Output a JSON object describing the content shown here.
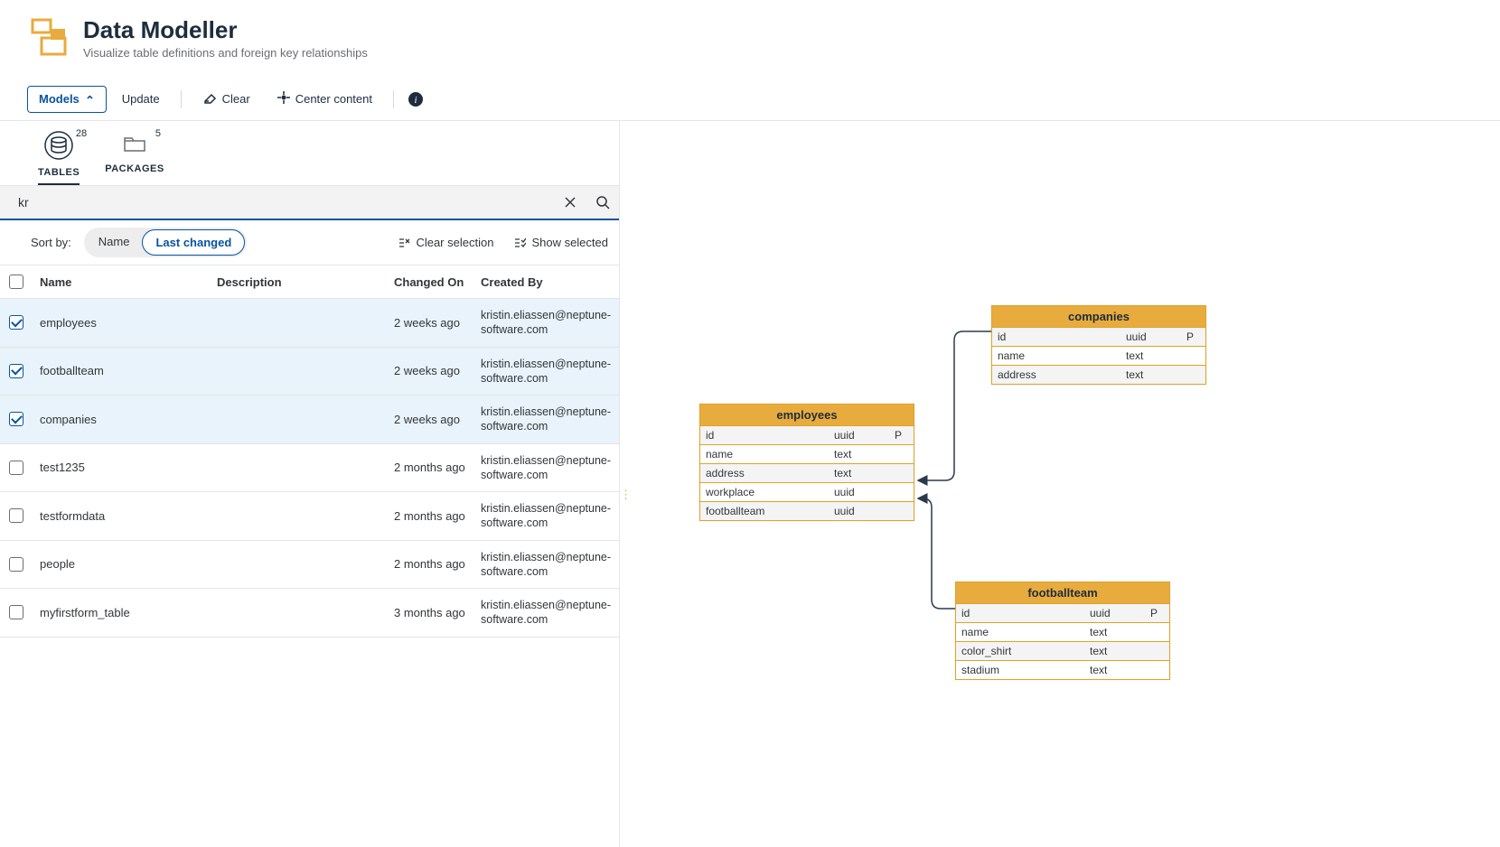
{
  "header": {
    "title": "Data Modeller",
    "subtitle": "Visualize table definitions and foreign key relationships"
  },
  "toolbar": {
    "models": "Models",
    "update": "Update",
    "clear": "Clear",
    "center": "Center content"
  },
  "tabs": {
    "tables": {
      "label": "Tables",
      "count": "28"
    },
    "packages": {
      "label": "Packages",
      "count": "5"
    }
  },
  "search": {
    "value": "kr"
  },
  "filter": {
    "sortLabel": "Sort by:",
    "sortOptions": {
      "name": "Name",
      "lastChanged": "Last changed"
    },
    "clearSelection": "Clear selection",
    "showSelected": "Show selected"
  },
  "columns": {
    "name": "Name",
    "description": "Description",
    "changedOn": "Changed On",
    "createdBy": "Created By"
  },
  "rows": [
    {
      "checked": true,
      "name": "employees",
      "description": "",
      "changedOn": "2 weeks ago",
      "createdBy": "kristin.eliassen@neptune-software.com"
    },
    {
      "checked": true,
      "name": "footballteam",
      "description": "",
      "changedOn": "2 weeks ago",
      "createdBy": "kristin.eliassen@neptune-software.com"
    },
    {
      "checked": true,
      "name": "companies",
      "description": "",
      "changedOn": "2 weeks ago",
      "createdBy": "kristin.eliassen@neptune-software.com"
    },
    {
      "checked": false,
      "name": "test1235",
      "description": "",
      "changedOn": "2 months ago",
      "createdBy": "kristin.eliassen@neptune-software.com"
    },
    {
      "checked": false,
      "name": "testformdata",
      "description": "",
      "changedOn": "2 months ago",
      "createdBy": "kristin.eliassen@neptune-software.com"
    },
    {
      "checked": false,
      "name": "people",
      "description": "",
      "changedOn": "2 months ago",
      "createdBy": "kristin.eliassen@neptune-software.com"
    },
    {
      "checked": false,
      "name": "myfirstform_table",
      "description": "",
      "changedOn": "3 months ago",
      "createdBy": "kristin.eliassen@neptune-software.com"
    }
  ],
  "entities": {
    "companies": {
      "title": "companies",
      "fields": [
        {
          "name": "id",
          "type": "uuid",
          "pk": "P"
        },
        {
          "name": "name",
          "type": "text",
          "pk": ""
        },
        {
          "name": "address",
          "type": "text",
          "pk": ""
        }
      ]
    },
    "employees": {
      "title": "employees",
      "fields": [
        {
          "name": "id",
          "type": "uuid",
          "pk": "P"
        },
        {
          "name": "name",
          "type": "text",
          "pk": ""
        },
        {
          "name": "address",
          "type": "text",
          "pk": ""
        },
        {
          "name": "workplace",
          "type": "uuid",
          "pk": ""
        },
        {
          "name": "footballteam",
          "type": "uuid",
          "pk": ""
        }
      ]
    },
    "footballteam": {
      "title": "footballteam",
      "fields": [
        {
          "name": "id",
          "type": "uuid",
          "pk": "P"
        },
        {
          "name": "name",
          "type": "text",
          "pk": ""
        },
        {
          "name": "color_shirt",
          "type": "text",
          "pk": ""
        },
        {
          "name": "stadium",
          "type": "text",
          "pk": ""
        }
      ]
    }
  }
}
